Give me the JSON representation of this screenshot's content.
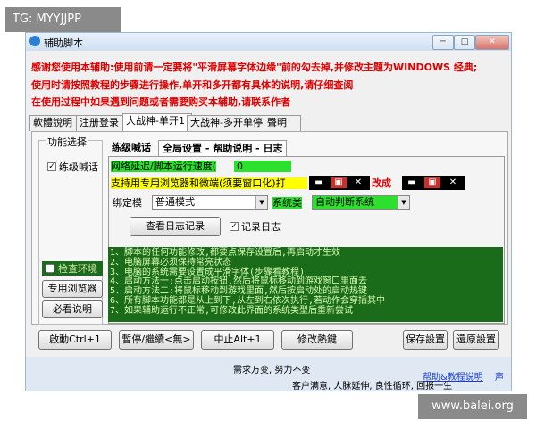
{
  "watermarks": {
    "top_left": "TG: MYYJJPP",
    "bottom_right": "www.balei.org"
  },
  "window": {
    "title": "辅助脚本",
    "min": "─",
    "max": "□",
    "close": "✕"
  },
  "notice": {
    "line1": "感谢您使用本辅助:使用前请一定要将\"平滑屏幕字体边缘\"前的勾去掉,并修改主题为WINDOWS 经典;",
    "line2": "使用时请按照教程的步骤进行操作,单开和多开都有具体的说明,请仔细查阅",
    "line3": "在使用过程中如果遇到问题或者需要购买本辅助,请联系作者",
    "colors": {
      "line1": "#e00000",
      "line2": "#e00000",
      "line3": "#e00000"
    }
  },
  "tabs": [
    "軟體說明",
    "注册登录",
    "大战神-单开1",
    "大战神-多开单停",
    "聲明"
  ],
  "left_group": {
    "legend": "功能选择",
    "practice_label": "练级喊话",
    "practice_checked": true,
    "check_env_label": "检查环境",
    "browser_button": "专用浏览器",
    "manual_button": "必看说明"
  },
  "inner_tabs": [
    "练级喊话",
    "全局设置 - 帮助说明 - 日志"
  ],
  "settings": {
    "delay_label": "网络延迟/脚本运行速度(",
    "delay_value": "0",
    "browser_note": "支持用专用浏览器和微端(须要窗口化)打",
    "change_label": "改成",
    "bind_label": "绑定模",
    "bind_value": "普通模式",
    "system_label": "系统类",
    "system_value": "自动判断系统",
    "view_log_button": "查看日志记录",
    "record_log_label": "记录日志",
    "record_log_checked": true
  },
  "help_lines": [
    "1、脚本的任何功能修改,都要点保存设置后,再启动才生效",
    "2、电脑屏幕必须保持常亮状态",
    "3、电脑的系统需要设置成平滑字体(步骤看教程)",
    "4、启动方法一:点击启动按钮,然后将鼠标移动到游戏窗口里面去",
    "5、启动方法二:将鼠标移动到游戏里面,然后按启动处的启动热键",
    "6、所有脚本功能都是从上到下,从左到右依次执行,若动作会穿插其中",
    "7、如果辅助运行不正常,可修改此界面的系统类型后重新尝试"
  ],
  "bottom_buttons": {
    "start": "啟動Ctrl+1",
    "pause": "暫停/繼續<無>",
    "stop": "中止Alt+1",
    "hotkey": "修改熱鍵",
    "save": "保存設置",
    "restore": "還原設置"
  },
  "footer": {
    "center": "需求万变, 努力不变",
    "link": "帮助&教程说明",
    "link2": "声",
    "bottom": "客户满意, 人脉延伸, 良性循环, 回报一生"
  }
}
